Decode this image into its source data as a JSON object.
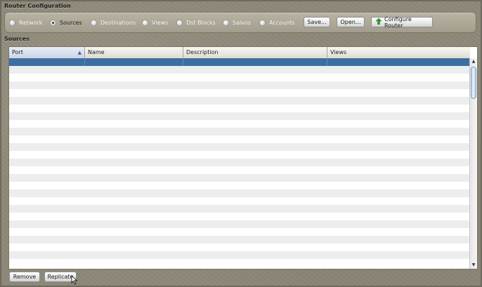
{
  "window": {
    "config_title": "Router Configuration",
    "sources_title": "Sources"
  },
  "config": {
    "options": [
      {
        "label": "Network",
        "selected": false
      },
      {
        "label": "Sources",
        "selected": true
      },
      {
        "label": "Destinations",
        "selected": false
      },
      {
        "label": "Views",
        "selected": false
      },
      {
        "label": "Dst Blocks",
        "selected": false
      },
      {
        "label": "Salvos",
        "selected": false
      },
      {
        "label": "Accounts",
        "selected": false
      }
    ],
    "save_label": "Save...",
    "open_label": "Open...",
    "configure_label": "Configure Router",
    "configure_icon": "up-arrow-green",
    "accent_green": "#2e9d2a"
  },
  "table": {
    "columns": [
      "Port",
      "Name",
      "Description",
      "Views"
    ],
    "sorted_column": "Port",
    "sort_icon": "sort-ascending-icon",
    "selected_row_color": "#3d6ea2",
    "rows": []
  },
  "actions": {
    "remove_label": "Remove",
    "replicate_label": "Replicate"
  }
}
